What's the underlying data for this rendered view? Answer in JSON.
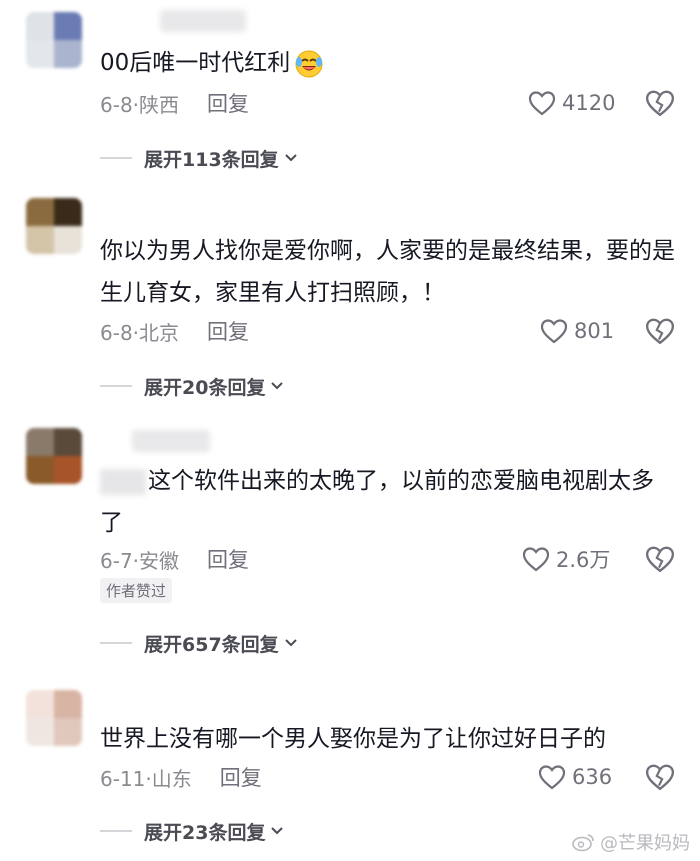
{
  "comments": [
    {
      "text": "00后唯一时代红利",
      "date_loc": "6-8·陕西",
      "reply": "回复",
      "likes": "4120",
      "expand": "展开113条回复"
    },
    {
      "text": "你以为男人找你是爱你啊，人家要的是最终结果，要的是生儿育女，家里有人打扫照顾，！",
      "date_loc": "6-8·北京",
      "reply": "回复",
      "likes": "801",
      "expand": "展开20条回复"
    },
    {
      "text": "这个软件出来的太晚了，以前的恋爱脑电视剧太多了",
      "date_loc": "6-7·安徽",
      "reply": "回复",
      "likes": "2.6万",
      "badge": "作者赞过",
      "expand": "展开657条回复"
    },
    {
      "text": "世界上没有哪一个男人娶你是为了让你过好日子的",
      "date_loc": "6-11·山东",
      "reply": "回复",
      "likes": "636",
      "expand": "展开23条回复"
    }
  ],
  "watermark": "@芒果妈妈",
  "icons": {
    "like": "heart-outline-icon",
    "dislike": "broken-heart-icon",
    "expand": "chevron-down-icon",
    "emoji": "laughing-crying-emoji-icon",
    "logo": "weibo-logo-icon"
  },
  "colors": {
    "text": "#161823",
    "meta": "#8a8b91",
    "secondary": "#6f7079"
  }
}
